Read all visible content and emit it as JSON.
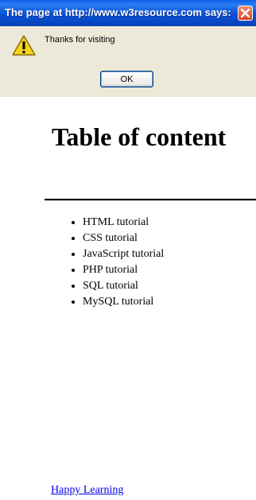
{
  "dialog": {
    "title": "The page at http://www.w3resource.com says:",
    "message": "Thanks for visiting",
    "ok_label": "OK",
    "icon": "warning-icon",
    "colors": {
      "titlebar": "#0a52d8",
      "body": "#ece9d8",
      "close_button": "#d6431f"
    }
  },
  "page": {
    "title": "Table of content",
    "items": [
      {
        "label": "HTML tutorial"
      },
      {
        "label": "CSS tutorial"
      },
      {
        "label": "JavaScript tutorial"
      },
      {
        "label": "PHP tutorial"
      },
      {
        "label": "SQL tutorial"
      },
      {
        "label": "MySQL tutorial"
      }
    ],
    "footer_link": "Happy Learning",
    "link_color": "#0000ee"
  }
}
